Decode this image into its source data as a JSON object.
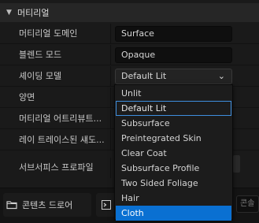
{
  "section": {
    "title": "머티리얼",
    "expand_glyph": "▼"
  },
  "properties": [
    {
      "label": "머티리얼 도메인",
      "value": "Surface"
    },
    {
      "label": "블렌드 모드",
      "value": "Opaque"
    },
    {
      "label": "셰이딩 모델",
      "value": "Default Lit"
    },
    {
      "label": "양면",
      "value": ""
    },
    {
      "label": "머티리얼 어트리뷰트...",
      "value": ""
    },
    {
      "label": "레이 트레이스된 섀도...",
      "value": ""
    },
    {
      "label": "서브서피스 프로파일",
      "value": ""
    }
  ],
  "shading_dropdown": {
    "caret": "⌄",
    "options": [
      "Unlit",
      "Default Lit",
      "Subsurface",
      "Preintegrated Skin",
      "Clear Coat",
      "Subsurface Profile",
      "Two Sided Foliage",
      "Hair",
      "Cloth"
    ],
    "focused": "Default Lit",
    "hovered": "Cloth"
  },
  "bottombar": {
    "content_drawer_label": "콘텐츠 드로어",
    "content_drawer_icon": "folder-icon",
    "cmd_icon": "terminal-icon",
    "console_placeholder": "콘솔"
  },
  "colors": {
    "accent": "#0a70d2",
    "focus_outline": "#3e8ede"
  }
}
